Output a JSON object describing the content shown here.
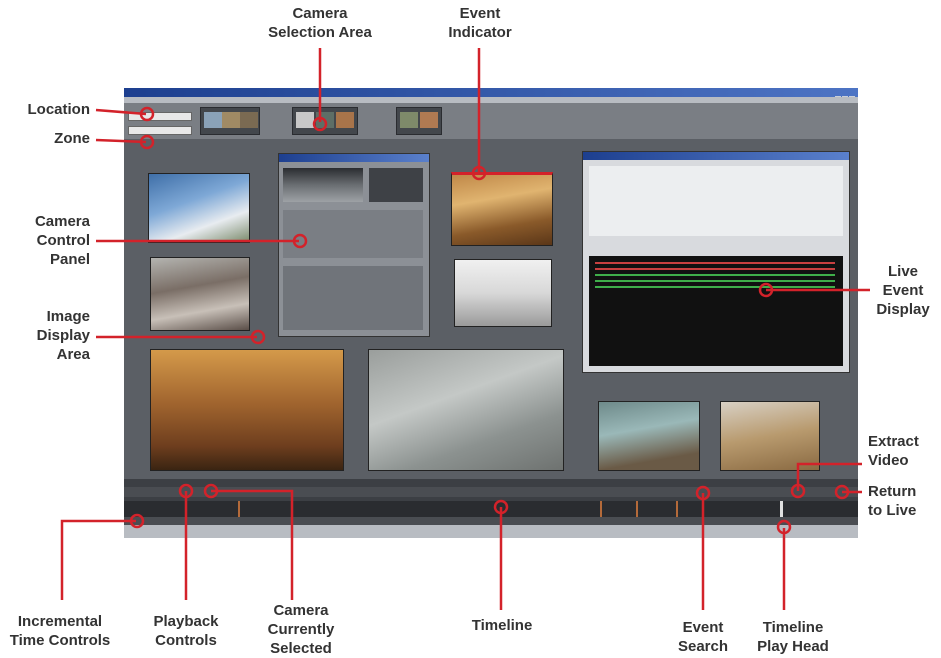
{
  "callouts": {
    "camera_selection": [
      "Camera",
      "Selection Area"
    ],
    "event_indicator": [
      "Event",
      "Indicator"
    ],
    "location": "Location",
    "zone": "Zone",
    "camera_control": [
      "Camera",
      "Control",
      "Panel"
    ],
    "image_display": [
      "Image",
      "Display",
      "Area"
    ],
    "live_event": [
      "Live",
      "Event",
      "Display"
    ],
    "extract_video": [
      "Extract",
      "Video"
    ],
    "return_live": [
      "Return",
      "to Live"
    ],
    "incremental": [
      "Incremental",
      "Time Controls"
    ],
    "playback": [
      "Playback",
      "Controls"
    ],
    "camera_selected": [
      "Camera",
      "Currently",
      "Selected"
    ],
    "timeline": "Timeline",
    "event_search": [
      "Event",
      "Search"
    ],
    "play_head": [
      "Timeline",
      "Play Head"
    ]
  },
  "colors": {
    "accent_red": "#d3222a",
    "callout_text": "#333333",
    "window_bg": "#55595e",
    "title_bar": "#1d3f8f"
  },
  "icons": {
    "marker": "circle-marker-icon"
  }
}
